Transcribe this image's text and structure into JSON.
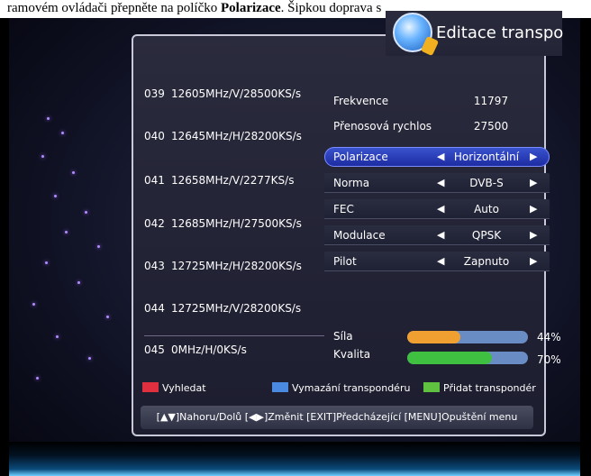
{
  "caption": {
    "prefix": "ramovém ovládači přepněte na políčko ",
    "bold": "Polarizace",
    "suffix": ". Šipkou doprava s"
  },
  "window": {
    "title": "Editace transpo"
  },
  "transponders": [
    {
      "num": "039",
      "desc": "12605MHz/V/28500KS/s"
    },
    {
      "num": "040",
      "desc": "12645MHz/H/28200KS/s"
    },
    {
      "num": "041",
      "desc": "12658MHz/V/2277KS/s"
    },
    {
      "num": "042",
      "desc": "12685MHz/H/27500KS/s"
    },
    {
      "num": "043",
      "desc": "12725MHz/H/28200KS/s"
    },
    {
      "num": "044",
      "desc": "12725MHz/V/28200KS/s"
    },
    {
      "num": "045",
      "desc": "0MHz/H/0KS/s"
    }
  ],
  "fields": {
    "frekvence": {
      "label": "Frekvence",
      "value": "11797"
    },
    "prenosova": {
      "label": "Přenosová rychlos",
      "value": "27500"
    },
    "polarizace": {
      "label": "Polarizace",
      "value": "Horizontální"
    },
    "norma": {
      "label": "Norma",
      "value": "DVB-S"
    },
    "fec": {
      "label": "FEC",
      "value": "Auto"
    },
    "modulace": {
      "label": "Modulace",
      "value": "QPSK"
    },
    "pilot": {
      "label": "Pilot",
      "value": "Zapnuto"
    }
  },
  "arrows": {
    "left": "◀",
    "right": "▶"
  },
  "signal": {
    "strength": {
      "label": "Síla",
      "value_text": "44%",
      "value": 44,
      "color": "#f0a030"
    },
    "quality": {
      "label": "Kvalita",
      "value_text": "70%",
      "value": 70,
      "color": "#40c040"
    }
  },
  "legend": {
    "red": {
      "label": "Vyhledat",
      "color": "#e03040"
    },
    "blue": {
      "label": "Vymazání transpondéru",
      "color": "#4a8ae0"
    },
    "green": {
      "label": "Přidat transpondér",
      "color": "#60c040"
    }
  },
  "help": {
    "text": "[▲▼]Nahoru/Dolů [◀▶]Změnit [EXIT]Předcházející [MENU]Opuštění menu"
  }
}
